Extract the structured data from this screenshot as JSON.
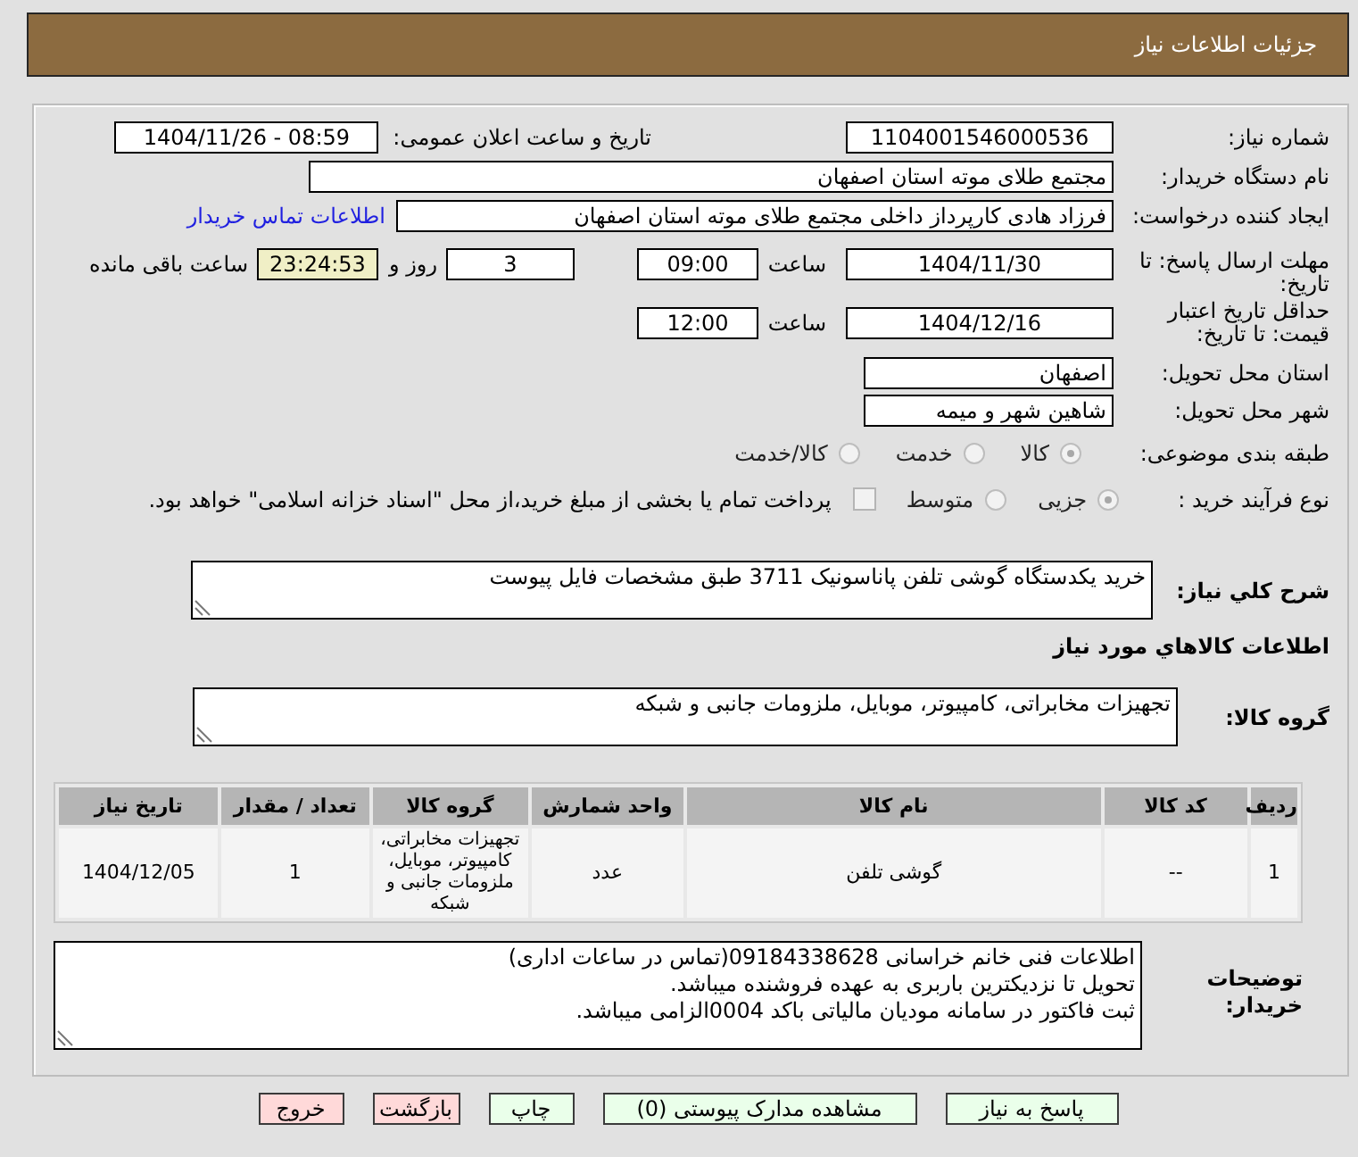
{
  "header": {
    "title": "جزئیات اطلاعات نیاز"
  },
  "need_number": {
    "label": "شماره نیاز:",
    "value": "1104001546000536"
  },
  "announcement": {
    "label": "تاریخ و ساعت اعلان عمومی:",
    "value": "1404/11/26 - 08:59"
  },
  "buyer_org": {
    "label": "نام دستگاه خریدار:",
    "value": "مجتمع طلای موته استان اصفهان"
  },
  "requester": {
    "label": "ایجاد کننده درخواست:",
    "value": "فرزاد هادی کارپرداز داخلی مجتمع طلای موته استان اصفهان",
    "contact_link": "اطلاعات تماس خریدار"
  },
  "reply_deadline": {
    "label": "مهلت ارسال پاسخ: تا تاریخ:",
    "date": "1404/11/30",
    "time_label": "ساعت",
    "time": "09:00",
    "days": "3",
    "days_label": "روز و",
    "remaining": "23:24:53",
    "remaining_label": "ساعت باقی مانده"
  },
  "price_validity": {
    "label": "حداقل تاریخ اعتبار قیمت: تا تاریخ:",
    "date": "1404/12/16",
    "time_label": "ساعت",
    "time": "12:00"
  },
  "delivery_province": {
    "label": "استان محل تحویل:",
    "value": "اصفهان"
  },
  "delivery_city": {
    "label": "شهر محل تحویل:",
    "value": "شاهین شهر و میمه"
  },
  "subject_category": {
    "label": "طبقه بندی موضوعی:",
    "options": [
      {
        "label": "کالا",
        "selected": true,
        "disabled": true
      },
      {
        "label": "خدمت",
        "selected": false,
        "disabled": true
      },
      {
        "label": "کالا/خدمت",
        "selected": false,
        "disabled": true
      }
    ]
  },
  "purchase_process": {
    "label": "نوع فرآیند خرید :",
    "options": [
      {
        "label": "جزیی",
        "selected": true,
        "disabled": true
      },
      {
        "label": "متوسط",
        "selected": false,
        "disabled": true
      }
    ],
    "treasury_payment": {
      "text": "پرداخت تمام یا بخشی از مبلغ خرید،از محل \"اسناد خزانه اسلامی\" خواهد بود.",
      "checked": false,
      "disabled": true
    }
  },
  "description": {
    "label": "شرح کلي نیاز:",
    "value": "خرید یکدستگاه گوشی تلفن پاناسونیک 3711 طبق مشخصات فایل پیوست"
  },
  "goods_section": {
    "title": "اطلاعات کالاهاي مورد نیاز"
  },
  "goods_group": {
    "label": "گروه کالا:",
    "value": "تجهیزات مخابراتی، کامپیوتر، موبایل، ملزومات جانبی و شبکه"
  },
  "goods_table": {
    "columns": [
      "ردیف",
      "کد کالا",
      "نام کالا",
      "واحد شمارش",
      "گروه کالا",
      "تعداد / مقدار",
      "تاریخ نیاز"
    ],
    "rows": [
      [
        "1",
        "--",
        "گوشی تلفن",
        "عدد",
        "تجهیزات مخابراتی، کامپیوتر، موبایل، ملزومات جانبی و شبکه",
        "1",
        "1404/12/05"
      ]
    ]
  },
  "buyer_notes": {
    "label": "توضیحات خریدار:",
    "lines": [
      "اطلاعات فنی خانم خراسانی 09184338628(تماس در ساعات اداری)",
      "تحویل تا نزدیکترین باربری به عهده فروشنده میباشد.",
      "ثبت فاکتور در سامانه مودیان مالیاتی باکد 0004الزامی میباشد."
    ]
  },
  "buttons": [
    {
      "label": "پاسخ به نیاز",
      "color": "#eaffea"
    },
    {
      "label": "مشاهده مدارک پیوستی (0)",
      "color": "#eaffea"
    },
    {
      "label": "چاپ",
      "color": "#eaffea"
    },
    {
      "label": "بازگشت",
      "color": "#ffd9d9"
    },
    {
      "label": "خروج",
      "color": "#ffd9d9"
    }
  ]
}
